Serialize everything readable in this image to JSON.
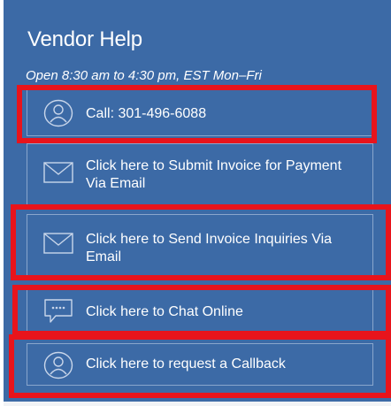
{
  "widget": {
    "title": "Vendor Help",
    "hours": "Open 8:30 am to 4:30 pm, EST Mon–Fri",
    "items": [
      {
        "label": "Call: 301-496-6088",
        "icon": "person-icon"
      },
      {
        "label": "Click here to Submit Invoice for Payment Via Email",
        "icon": "envelope-icon"
      },
      {
        "label": "Click here to Send Invoice Inquiries Via Email",
        "icon": "envelope-icon"
      },
      {
        "label": "Click here to Chat Online",
        "icon": "chat-bubble-icon"
      },
      {
        "label": "Click here to request a Callback",
        "icon": "person-icon"
      }
    ]
  },
  "colors": {
    "panel_background": "#3c6aa6",
    "text": "#ffffff",
    "highlight_border": "#e8141c"
  }
}
